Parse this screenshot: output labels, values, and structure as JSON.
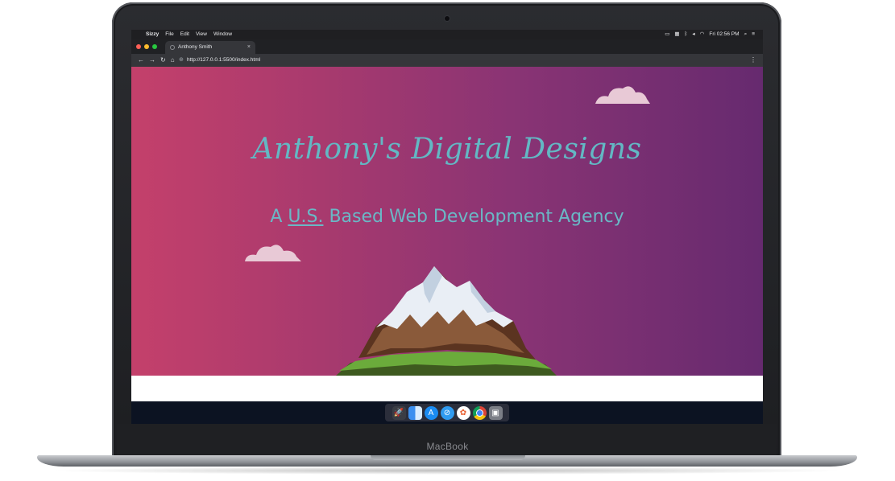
{
  "device": {
    "brand": "MacBook"
  },
  "menubar": {
    "apple_icon": "apple-icon",
    "app_name": "Sizzy",
    "menus": [
      "File",
      "Edit",
      "View",
      "Window"
    ],
    "clock": "Fri 02:56 PM"
  },
  "browser": {
    "tab": {
      "title": "Anthony Smith",
      "close": "×"
    },
    "url": "http://127.0.0.1:5500/index.html"
  },
  "page": {
    "title": "Anthony's Digital Designs",
    "tagline_prefix": "A ",
    "tagline_us": "U.S.",
    "tagline_suffix": " Based Web Development Agency",
    "gradient_start": "#c4406b",
    "gradient_end": "#662a6f",
    "title_color": "#63b8c4"
  },
  "dock": {
    "apps": [
      "launchpad-icon",
      "finder-icon",
      "app-store-icon",
      "safari-icon",
      "photos-icon",
      "chrome-icon",
      "preview-icon"
    ]
  }
}
